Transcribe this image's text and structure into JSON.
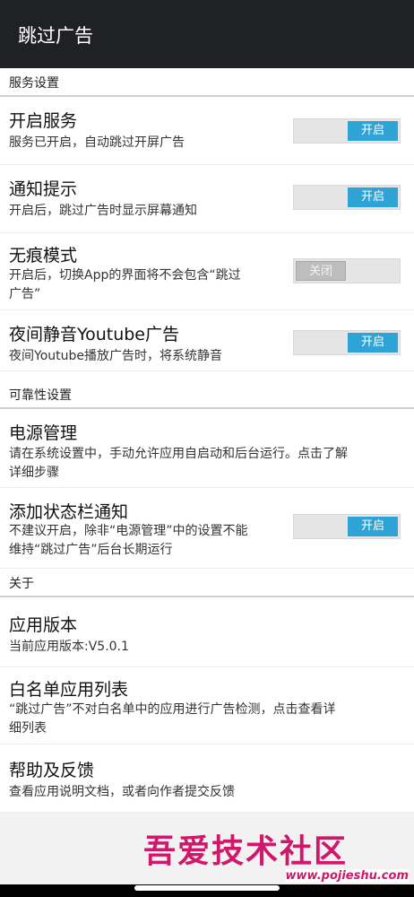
{
  "appbar": {
    "title": "跳过广告"
  },
  "sections": {
    "service": "服务设置",
    "reliability": "可靠性设置",
    "about": "关于"
  },
  "items": {
    "enable_service": {
      "title": "开启服务",
      "sub": "服务已开启，自动跳过开屏广告",
      "toggle": "开启",
      "on": true
    },
    "notify": {
      "title": "通知提示",
      "sub": "开启后，跳过广告时显示屏幕通知",
      "toggle": "开启",
      "on": true
    },
    "incognito": {
      "title": "无痕模式",
      "sub1": "开启后，切换App的界面将不会包含“跳过",
      "sub2": "广告”",
      "toggle": "关闭",
      "on": false
    },
    "night_mute": {
      "title": "夜间静音Youtube广告",
      "sub": "夜间Youtube播放广告时，将系统静音",
      "toggle": "开启",
      "on": true
    },
    "power": {
      "title": "电源管理",
      "sub1": "请在系统设置中，手动允许应用自启动和后台运行。点击了解",
      "sub2": "详细步骤"
    },
    "status_notify": {
      "title": "添加状态栏通知",
      "sub1": "不建议开启，除非“电源管理”中的设置不能",
      "sub2": "维持“跳过广告”后台长期运行",
      "toggle": "开启",
      "on": true
    },
    "version": {
      "title": "应用版本",
      "sub": "当前应用版本:V5.0.1"
    },
    "whitelist": {
      "title": "白名单应用列表",
      "sub1": "“跳过广告”不对白名单中的应用进行广告检测，点击查看详",
      "sub2": "细列表"
    },
    "help": {
      "title": "帮助及反馈",
      "sub": "查看应用说明文档，或者向作者提交反馈"
    }
  },
  "watermark": {
    "text": "吾爱技术社区",
    "url": "www.pojieshu.com"
  },
  "colors": {
    "appbar": "#202124",
    "toggle_on": "#2ea4d6",
    "toggle_off": "#bdbdbd",
    "watermark": "#d0186a"
  }
}
